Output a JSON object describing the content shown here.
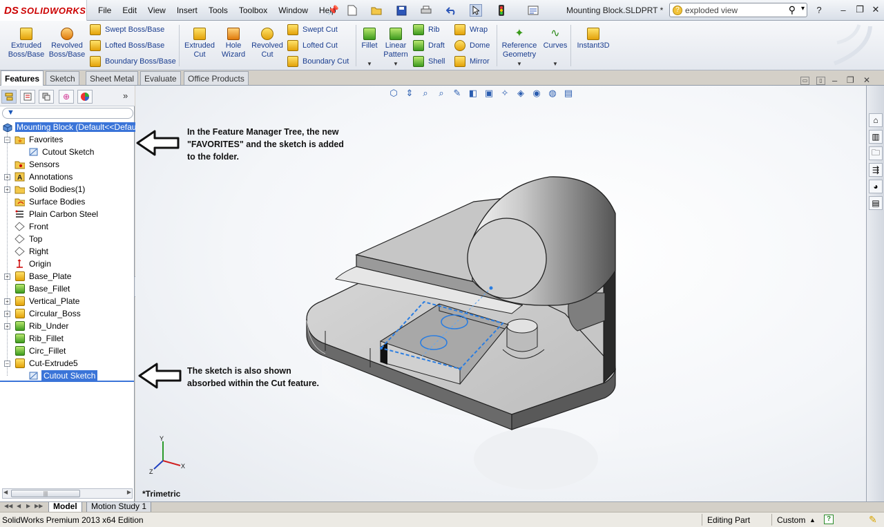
{
  "app": {
    "logo_ds": "DS",
    "logo_name": "SOLIDWORKS",
    "document_title": "Mounting Block.SLDPRT *"
  },
  "menu": [
    "File",
    "Edit",
    "View",
    "Insert",
    "Tools",
    "Toolbox",
    "Window",
    "Help"
  ],
  "search": {
    "value": "exploded view"
  },
  "command_manager": {
    "extruded_boss": "Extruded Boss/Base",
    "revolved_boss": "Revolved Boss/Base",
    "swept_boss": "Swept Boss/Base",
    "lofted_boss": "Lofted Boss/Base",
    "boundary_boss": "Boundary Boss/Base",
    "extruded_cut": "Extruded Cut",
    "hole_wizard": "Hole Wizard",
    "revolved_cut": "Revolved Cut",
    "swept_cut": "Swept Cut",
    "lofted_cut": "Lofted Cut",
    "boundary_cut": "Boundary Cut",
    "fillet": "Fillet",
    "linear_pattern": "Linear Pattern",
    "rib": "Rib",
    "draft": "Draft",
    "shell": "Shell",
    "wrap": "Wrap",
    "dome": "Dome",
    "mirror": "Mirror",
    "reference_geometry": "Reference Geometry",
    "curves": "Curves",
    "instant3d": "Instant3D"
  },
  "tabs": [
    "Features",
    "Sketch",
    "Sheet Metal",
    "Evaluate",
    "Office Products"
  ],
  "tree": {
    "root": "Mounting Block  (Default<<Default>",
    "items": [
      {
        "label": "Favorites"
      },
      {
        "label": "Cutout Sketch"
      },
      {
        "label": "Sensors"
      },
      {
        "label": "Annotations"
      },
      {
        "label": "Solid Bodies(1)"
      },
      {
        "label": "Surface Bodies"
      },
      {
        "label": "Plain Carbon Steel"
      },
      {
        "label": "Front"
      },
      {
        "label": "Top"
      },
      {
        "label": "Right"
      },
      {
        "label": "Origin"
      },
      {
        "label": "Base_Plate"
      },
      {
        "label": "Base_Fillet"
      },
      {
        "label": "Vertical_Plate"
      },
      {
        "label": "Circular_Boss"
      },
      {
        "label": "Rib_Under"
      },
      {
        "label": "Rib_Fillet"
      },
      {
        "label": "Circ_Fillet"
      },
      {
        "label": "Cut-Extrude5"
      },
      {
        "label": "Cutout Sketch"
      }
    ]
  },
  "annotations": {
    "note1_line1": "In the Feature Manager Tree, the new",
    "note1_line2": "\"FAVORITES\" and the sketch is added",
    "note1_line3": "to the folder.",
    "note2_line1": "The sketch is also shown",
    "note2_line2": "absorbed within the Cut feature."
  },
  "triad": {
    "x": "X",
    "y": "Y",
    "z": "Z"
  },
  "view": {
    "orientation": "*Trimetric"
  },
  "bottom_tabs": [
    "Model",
    "Motion Study 1"
  ],
  "status": {
    "edition": "SolidWorks Premium 2013 x64 Edition",
    "mode": "Editing Part",
    "units": "Custom"
  }
}
